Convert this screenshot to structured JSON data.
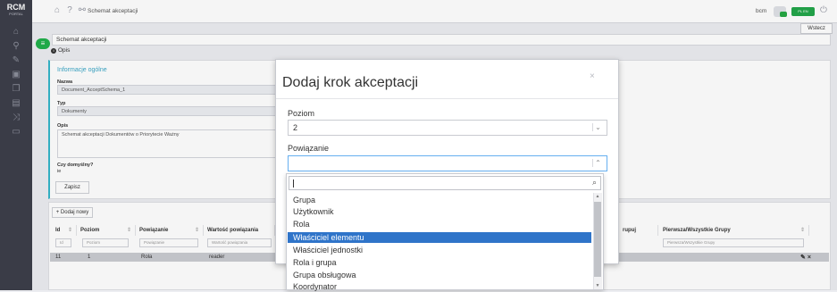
{
  "app": {
    "logo": "RCM",
    "logo_sub": "PORTAL"
  },
  "topbar": {
    "title": "Schemat akceptacji",
    "user": "bcm",
    "lang_badge": "PL  EN"
  },
  "back_button": "Wstecz",
  "breadcrumb": "Schemat akceptacji",
  "tab_opis": "Opis",
  "info": {
    "title": "Informacje ogólne",
    "name_label": "Nazwa",
    "name_value": "Document_AcceptSchema_1",
    "type_label": "Typ",
    "type_value": "Dokumenty",
    "desc_label": "Opis",
    "desc_value": "Schemat akceptacji Dokumentów o Priorytecie Ważny",
    "default_label": "Czy domyślny?",
    "default_value": "ie",
    "save_label": "Zapisz"
  },
  "table": {
    "add_new": "+ Dodaj nowy",
    "headers": [
      "Id",
      "Poziom",
      "Powiązanie",
      "Wartość powiązania",
      "rupuj",
      "Pierwsza/Wszystkie Grupy"
    ],
    "filters": [
      "Id",
      "Poziom",
      "Powiązanie",
      "Wartość powiązania",
      "Pierwsza/Wszystkie Grupy"
    ],
    "rows": [
      {
        "id": "11",
        "level": "1",
        "relation": "Rola",
        "value": "reader"
      }
    ]
  },
  "modal": {
    "title": "Dodaj krok akceptacji",
    "close": "×",
    "level_label": "Poziom",
    "level_value": "2",
    "relation_label": "Powiązanie",
    "options": [
      "Grupa",
      "Użytkownik",
      "Rola",
      "Właściciel elementu",
      "Właściciel jednostki",
      "Rola i grupa",
      "Grupa obsługowa",
      "Koordynator"
    ],
    "active_index": 3
  },
  "colors": {
    "accent": "#22b04b",
    "highlight": "#2f74c9",
    "sidebar": "#3d3f4a"
  }
}
